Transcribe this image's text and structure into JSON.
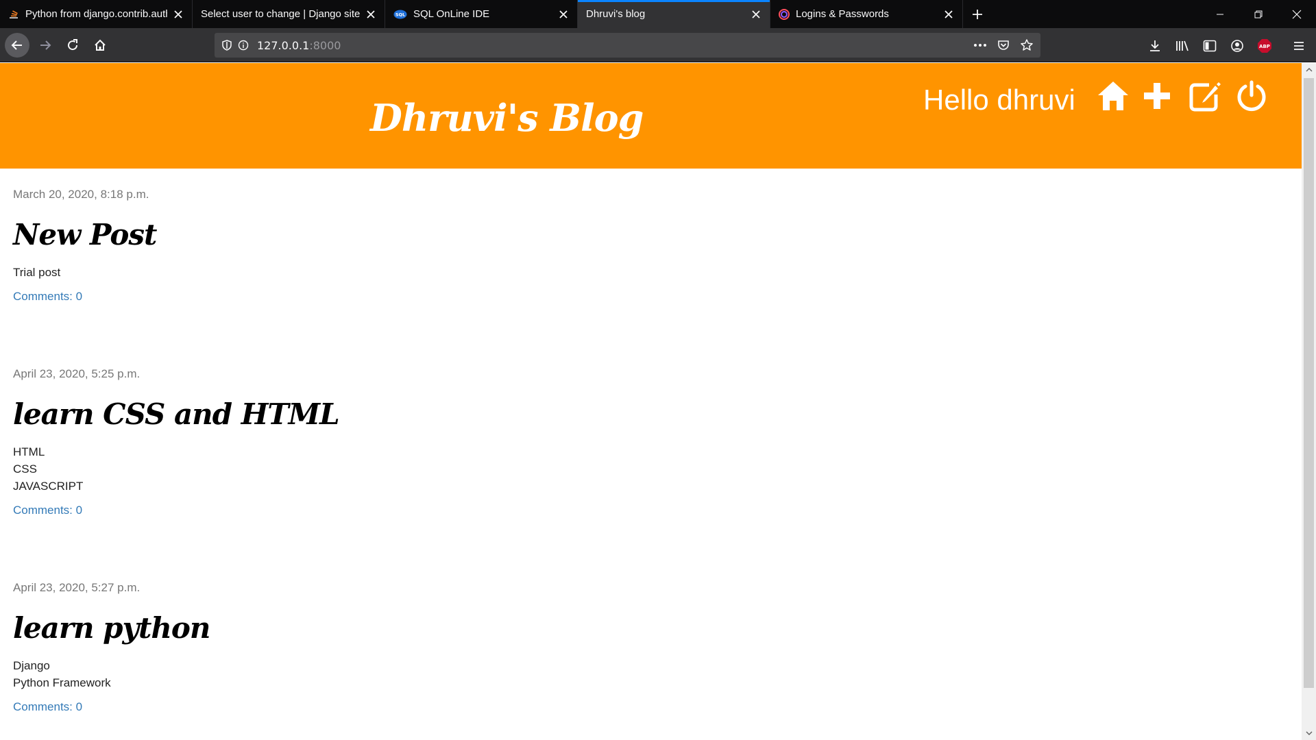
{
  "browser": {
    "tabs": [
      {
        "title": "Python from django.contrib.auth",
        "favicon": "stackoverflow-icon",
        "active": false
      },
      {
        "title": "Select user to change | Django site",
        "favicon": "none",
        "active": false
      },
      {
        "title": "SQL OnLine IDE",
        "favicon": "sql-icon",
        "active": false
      },
      {
        "title": "Dhruvi's blog",
        "favicon": "none",
        "active": true
      },
      {
        "title": "Logins & Passwords",
        "favicon": "lockwise-icon",
        "active": false
      }
    ],
    "url_host": "127.0.0.1",
    "url_port": ":8000",
    "sql_badge": "SQL",
    "abp_badge": "ABP",
    "accent": "#0a84ff"
  },
  "site": {
    "brand": "Dhruvi's Blog",
    "greeting": "Hello dhruvi",
    "header_color": "#ff9400",
    "link_color": "#337ab7"
  },
  "posts": [
    {
      "date": "March 20, 2020, 8:18 p.m.",
      "title": "New Post",
      "lines": [
        "Trial post"
      ],
      "comments": "Comments: 0"
    },
    {
      "date": "April 23, 2020, 5:25 p.m.",
      "title": "learn CSS and HTML",
      "lines": [
        "HTML",
        "CSS",
        "JAVASCRIPT"
      ],
      "comments": "Comments: 0"
    },
    {
      "date": "April 23, 2020, 5:27 p.m.",
      "title": "learn python",
      "lines": [
        "Django",
        "Python Framework"
      ],
      "comments": "Comments: 0"
    }
  ]
}
